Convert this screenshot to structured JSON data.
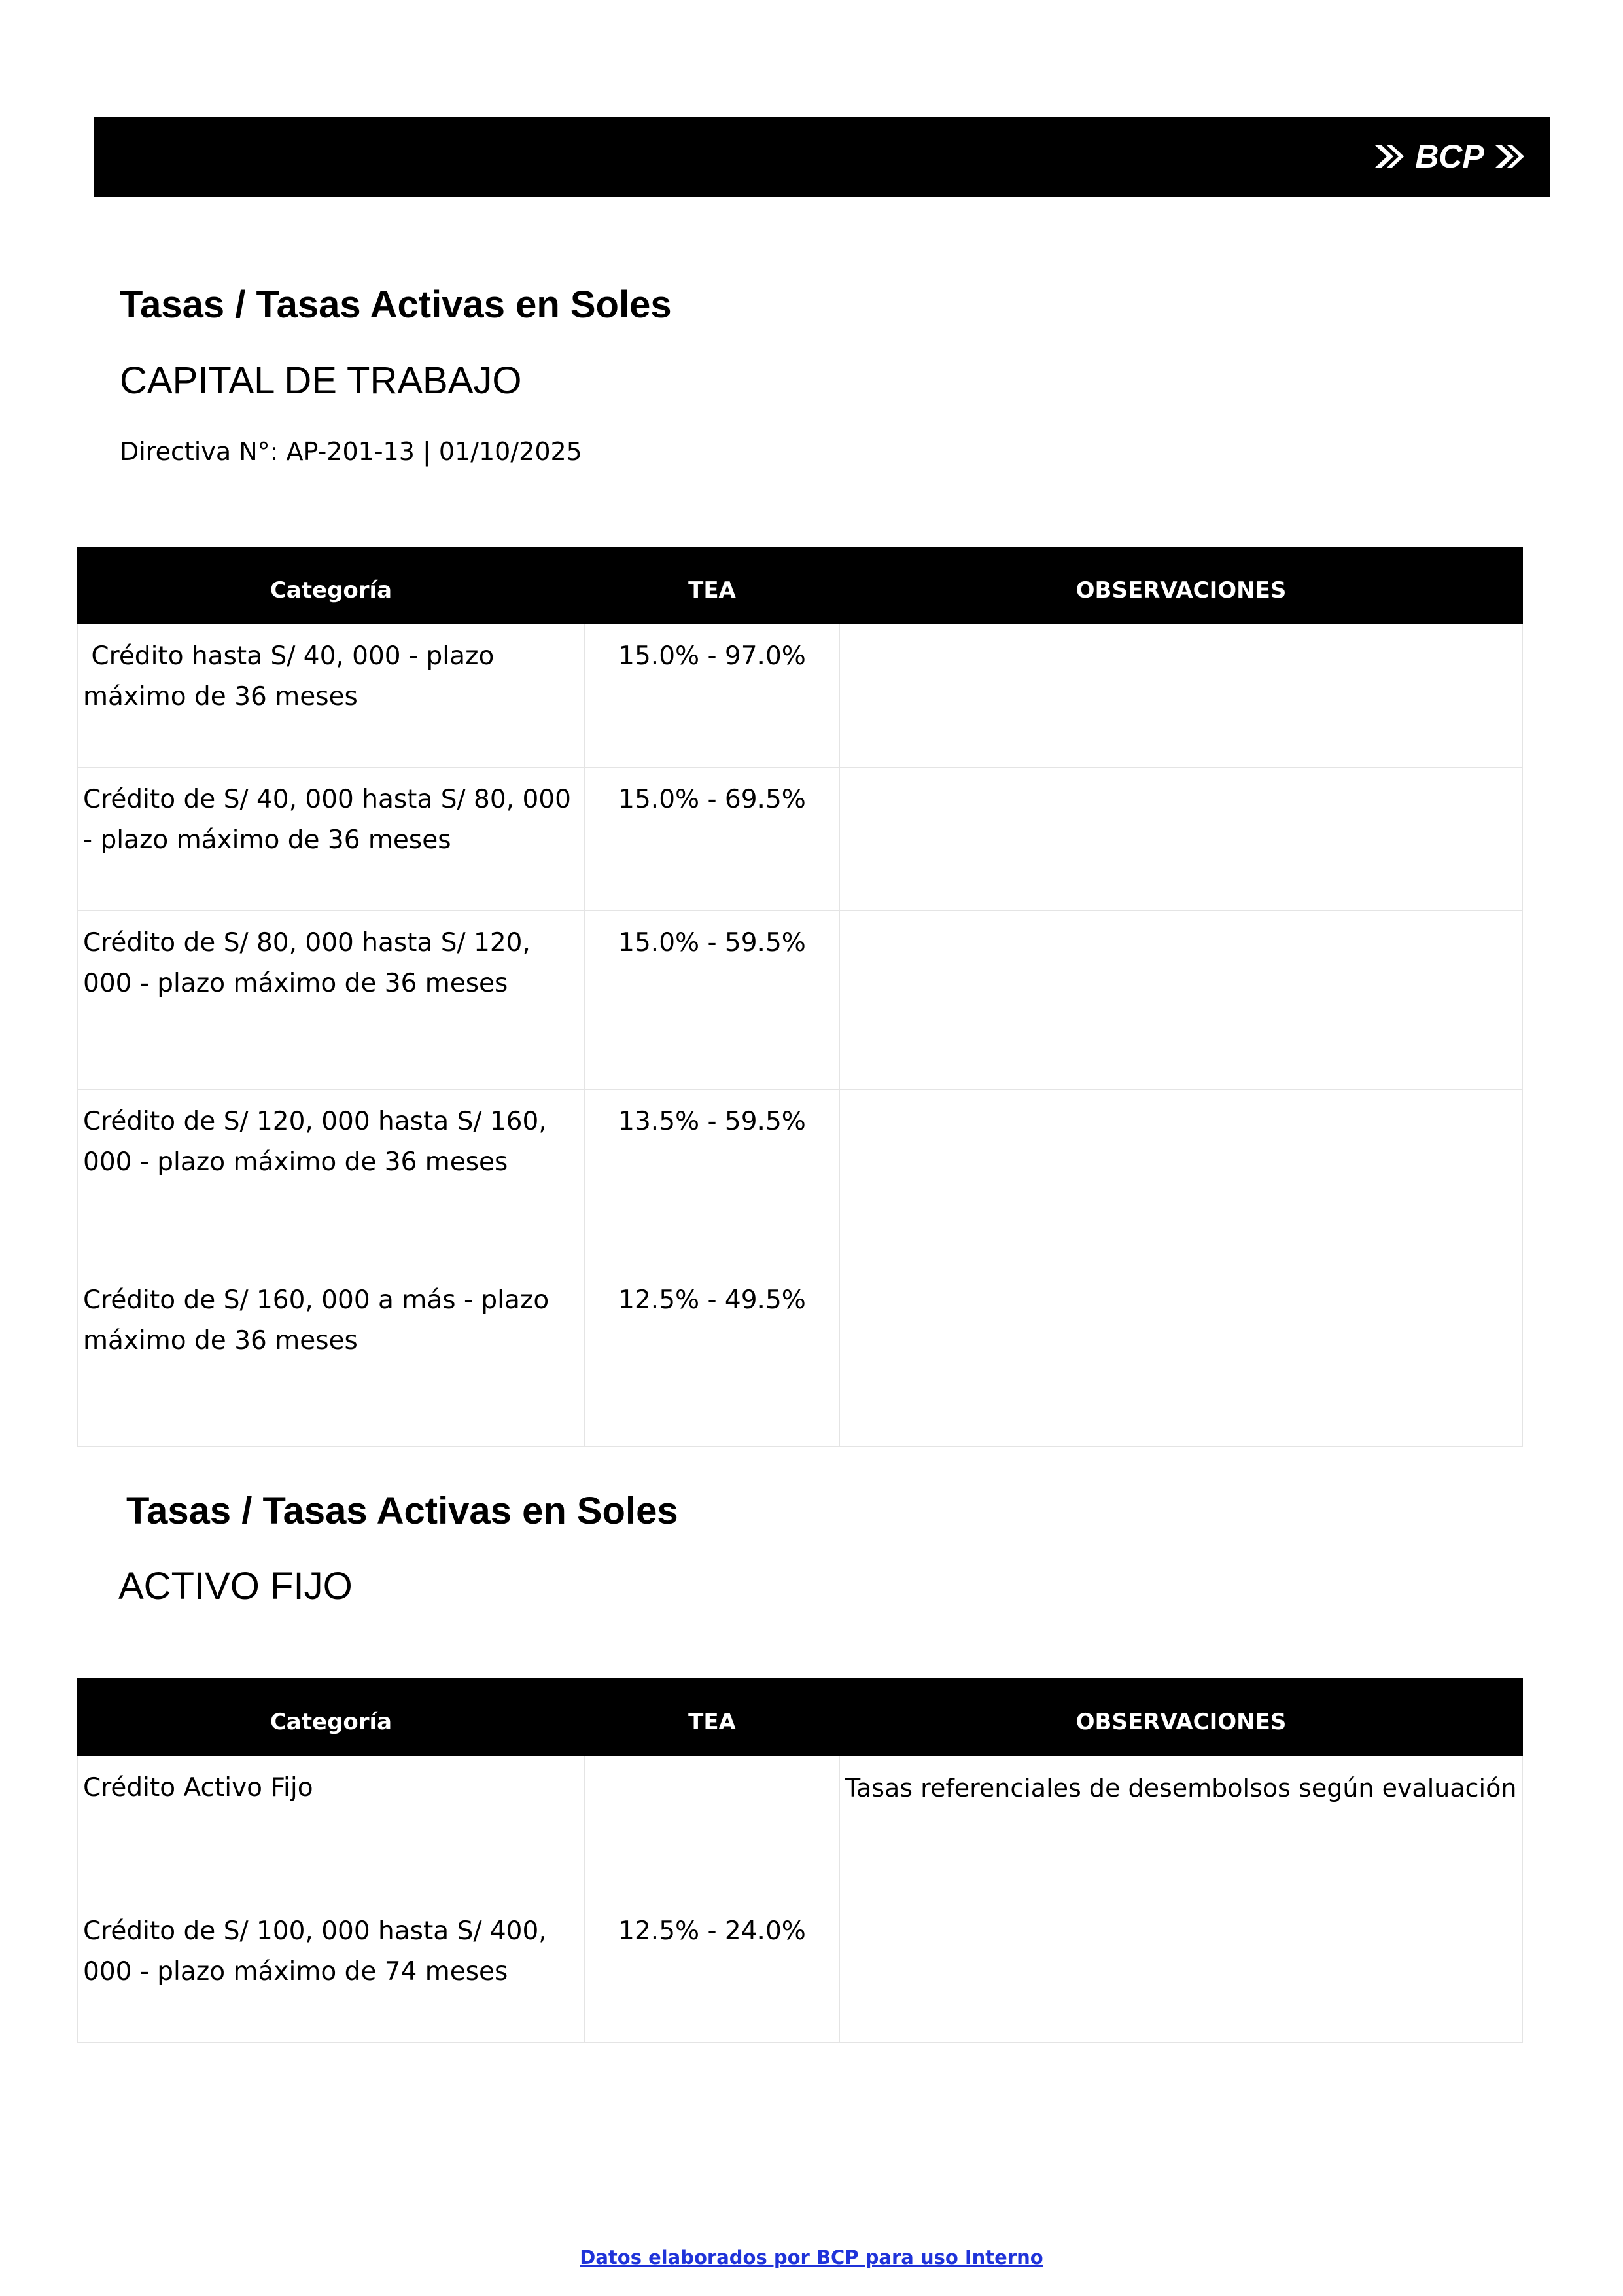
{
  "header": {
    "logo_text": "BCP",
    "logo_color": "#ffffff",
    "bar_color": "#000000"
  },
  "section1": {
    "title": "Tasas / Tasas Activas en Soles",
    "subtitle": "CAPITAL DE TRABAJO",
    "directive": "Directiva N°: AP-201-13 | 01/10/2025"
  },
  "table1": {
    "headers": [
      "Categoría",
      "TEA",
      "OBSERVACIONES"
    ],
    "rows": [
      {
        "category": " Crédito hasta S/ 40, 000 - plazo máximo de 36 meses",
        "tea": "15.0% - 97.0%",
        "obs": ""
      },
      {
        "category": "Crédito de S/ 40, 000 hasta S/ 80, 000 - plazo máximo de 36 meses",
        "tea": "15.0% - 69.5%",
        "obs": ""
      },
      {
        "category": "Crédito de S/ 80, 000 hasta S/ 120, 000 - plazo máximo de 36 meses",
        "tea": "15.0% - 59.5%",
        "obs": ""
      },
      {
        "category": "Crédito de S/ 120, 000 hasta S/ 160, 000 - plazo máximo de 36 meses",
        "tea": "13.5% - 59.5%",
        "obs": ""
      },
      {
        "category": "Crédito de S/ 160, 000 a más - plazo máximo de 36 meses",
        "tea": "12.5% - 49.5%",
        "obs": ""
      }
    ]
  },
  "section2": {
    "title": "Tasas / Tasas Activas en Soles",
    "subtitle": "ACTIVO FIJO"
  },
  "table2": {
    "headers": [
      "Categoría",
      "TEA",
      "OBSERVACIONES"
    ],
    "rows": [
      {
        "category": "Crédito Activo Fijo",
        "tea": "",
        "obs": "Tasas referenciales de desembolsos según evaluación"
      },
      {
        "category": "Crédito de S/ 100, 000 hasta S/ 400, 000 - plazo máximo de 74 meses",
        "tea": "12.5% - 24.0%",
        "obs": ""
      }
    ]
  },
  "footer": {
    "text": "Datos elaborados por BCP para uso Interno",
    "color": "#1f33d9"
  }
}
